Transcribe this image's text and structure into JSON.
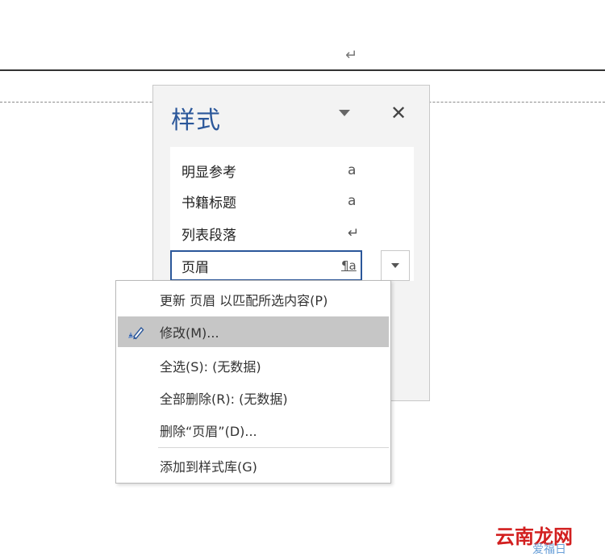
{
  "document": {
    "paragraph_mark": "↵"
  },
  "styles_pane": {
    "title": "样式",
    "close_label": "✕",
    "items": [
      {
        "label": "明显参考",
        "marker": "a"
      },
      {
        "label": "书籍标题",
        "marker": "a"
      },
      {
        "label": "列表段落",
        "marker": "↵"
      },
      {
        "label": "页眉",
        "marker": "¶a",
        "selected": true
      }
    ]
  },
  "context_menu": {
    "items": [
      {
        "label": "更新 页眉 以匹配所选内容(P)"
      },
      {
        "label": "修改(M)...",
        "icon": "pen-icon",
        "highlighted": true
      },
      {
        "label": "全选(S): (无数据)"
      },
      {
        "label": "全部删除(R): (无数据)"
      },
      {
        "label": "删除“页眉”(D)..."
      },
      {
        "label": "添加到样式库(G)"
      }
    ]
  },
  "watermark": {
    "text": "云南龙网",
    "subtext": "爱福日"
  },
  "colors": {
    "accent": "#2b579a",
    "highlight": "#c6c6c6",
    "watermark": "#d21f1f"
  }
}
